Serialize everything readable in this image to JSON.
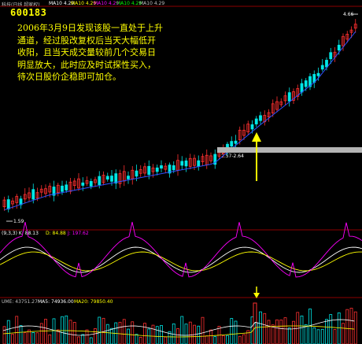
{
  "header": {
    "title": "科技(日线 超家权)",
    "ma5": "MA10 4.29",
    "ma10": "MA10 4.29",
    "ma20": "MA10 4.29",
    "ma30": "MA10 4.29",
    "ma60": "MA10 4.29",
    "colors": {
      "title": "#c0c0c0",
      "ma5": "#ffffff",
      "ma10": "#ffff00",
      "ma20": "#ff00ff",
      "ma30": "#00ff00",
      "ma60": "#c0c0c0"
    }
  },
  "stock_code": "600183",
  "annotation": {
    "lines": [
      "2006年3月9日发现该股一直处于上升",
      "通道，经过股改复权后当天大幅低开",
      "收阳，且当天成交量较前几个交易日",
      "明显放大，此时应及时试探性买入，",
      "待次日股价企稳即可加仓。"
    ]
  },
  "price_labels": {
    "high": "4.66",
    "low": "1.59",
    "signal": "2.57-2.64"
  },
  "kdj": {
    "k_label": "(9,3,3) K: 88.13",
    "d_label": "D: 84.88",
    "j_label": "J: 197.62",
    "colors": {
      "k": "#ffffff",
      "d": "#ffff00",
      "j": "#ff00ff"
    }
  },
  "volume": {
    "vol_label": "UME: 43751.27",
    "ma5_label": "MA5: 74936.00",
    "ma20_label": "MA20: 79850.40",
    "colors": {
      "vol": "#c0c0c0",
      "ma5": "#ffffff",
      "ma20": "#ffff00"
    }
  },
  "colors": {
    "up": "#ff3030",
    "down": "#00e6e6",
    "arrow": "#ffff00",
    "band": "#b4b4b4",
    "ma_line": "#3050ff",
    "grid": "#8b0000"
  }
}
